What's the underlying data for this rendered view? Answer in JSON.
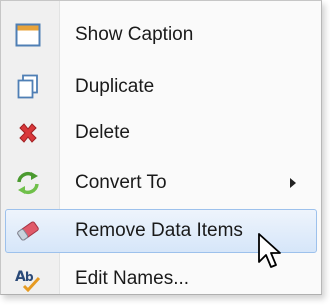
{
  "menu": {
    "items": [
      {
        "label": "Show Caption",
        "icon": "caption-window-icon"
      },
      {
        "label": "Duplicate",
        "icon": "duplicate-icon"
      },
      {
        "label": "Delete",
        "icon": "delete-x-icon"
      },
      {
        "label": "Convert To",
        "icon": "convert-arrows-icon",
        "has_submenu": true
      },
      {
        "label": "Remove Data Items",
        "icon": "eraser-icon",
        "highlighted": true
      },
      {
        "label": "Edit Names...",
        "icon": "spellcheck-ab-icon"
      }
    ]
  },
  "colors": {
    "highlight_border": "#9dc1ec",
    "highlight_fill": "#d6e6f9",
    "delete_red": "#d9383a",
    "convert_green": "#4a9a2f"
  }
}
